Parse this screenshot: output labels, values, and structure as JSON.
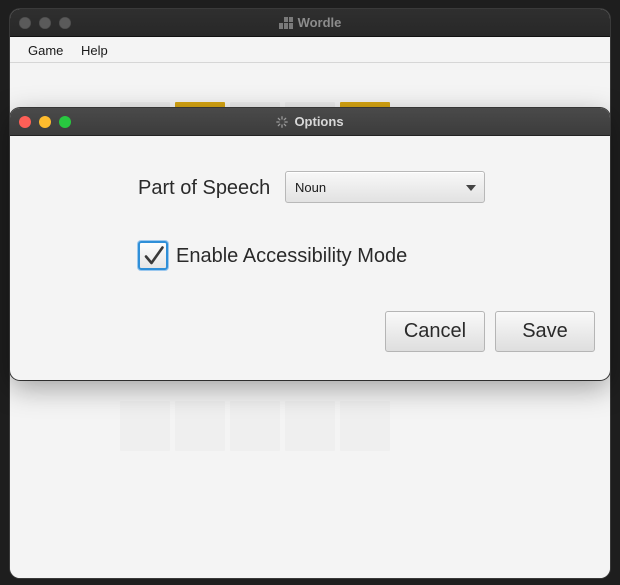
{
  "main_window": {
    "title": "Wordle",
    "menu": [
      "Game",
      "Help"
    ]
  },
  "dialog": {
    "title": "Options",
    "part_of_speech": {
      "label": "Part of Speech",
      "selected": "Noun"
    },
    "accessibility": {
      "label": "Enable Accessibility Mode",
      "checked": true
    },
    "buttons": {
      "cancel": "Cancel",
      "save": "Save"
    }
  },
  "colors": {
    "tile_yellow": "#d5a413",
    "focus_blue": "#2f8fd8",
    "close": "#fe5f57",
    "minimize": "#febc2e",
    "zoom": "#28c840"
  },
  "icons": {
    "main_title_icon": "grid-icon",
    "dialog_title_icon": "spinner-icon",
    "select_arrow": "chevron-down-icon",
    "checkbox_mark": "checkmark-icon"
  }
}
